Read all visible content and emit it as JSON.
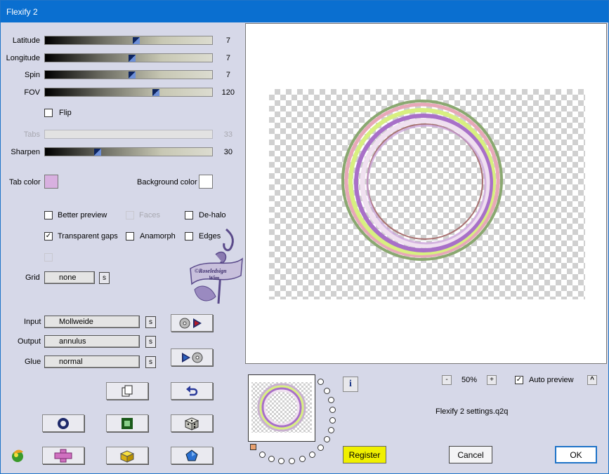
{
  "window": {
    "title": "Flexify 2"
  },
  "sliders": [
    {
      "label": "Latitude",
      "value": "7"
    },
    {
      "label": "Longitude",
      "value": "7"
    },
    {
      "label": "Spin",
      "value": "7"
    },
    {
      "label": "FOV",
      "value": "120"
    },
    {
      "label": "Tabs",
      "value": "33"
    },
    {
      "label": "Sharpen",
      "value": "30"
    }
  ],
  "flip": {
    "label": "Flip"
  },
  "colors": {
    "tab_label": "Tab color",
    "tab_color": "#d8b0e0",
    "background_label": "Background color",
    "background_color": "#ffffff"
  },
  "options": {
    "better_preview": "Better preview",
    "faces": "Faces",
    "de_halo": "De-halo",
    "transparent_gaps": "Transparent gaps",
    "anamorph": "Anamorph",
    "edges": "Edges"
  },
  "grid": {
    "label": "Grid",
    "value": "none",
    "s": "s"
  },
  "io": {
    "input_label": "Input",
    "input_value": "Mollweide",
    "output_label": "Output",
    "output_value": "annulus",
    "glue_label": "Glue",
    "glue_value": "normal",
    "s": "s"
  },
  "watermark": {
    "line1": "©Roseledsign",
    "line2": "Wim"
  },
  "zoom": {
    "minus": "-",
    "value": "50%",
    "plus": "+"
  },
  "auto_preview": {
    "label": "Auto preview",
    "checked": "✓",
    "arrow": "^"
  },
  "settings_file": "Flexify 2 settings.q2q",
  "buttons": {
    "register": "Register",
    "cancel": "Cancel",
    "ok": "OK",
    "info": "i"
  },
  "accent_colors": {
    "title_bar": "#0a6fd0",
    "register_bg": "#f0f000"
  }
}
